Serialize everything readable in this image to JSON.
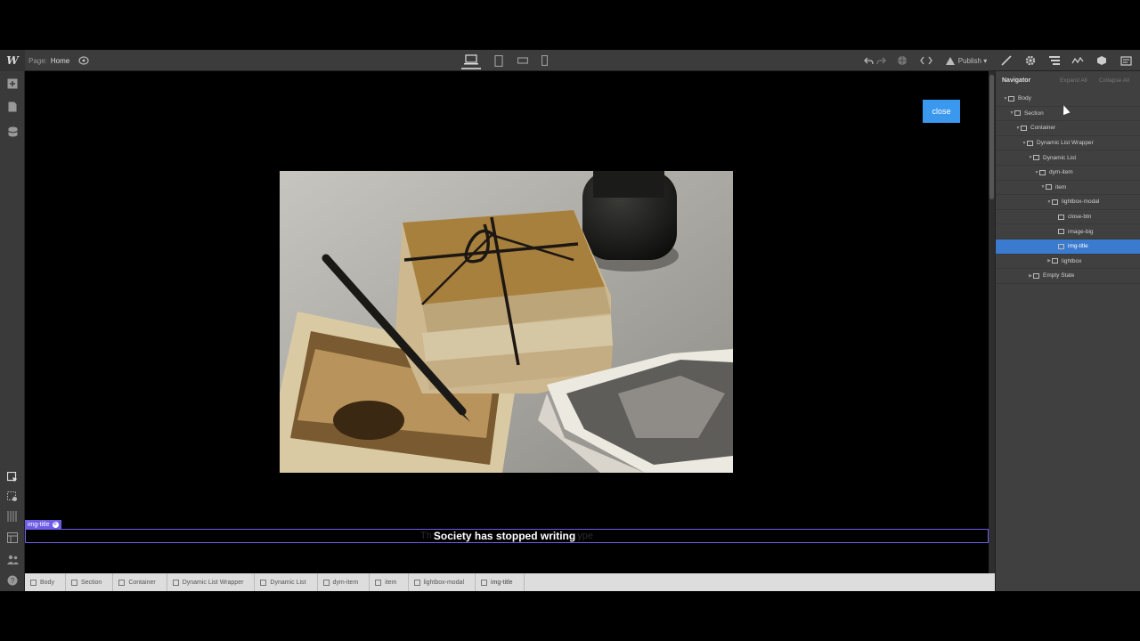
{
  "topbar": {
    "logo": "W",
    "page_prefix": "Page:",
    "page_name": "Home",
    "publish_label": "Publish ▾"
  },
  "canvas": {
    "close_label": "close",
    "img_title": "Society has stopped writing",
    "img_title_ghost_left": "Th",
    "img_title_ghost_right": "ype",
    "selection_tag": "img-title"
  },
  "breadcrumb": [
    "Body",
    "Section",
    "Container",
    "Dynamic List Wrapper",
    "Dynamic List",
    "dym-item",
    "item",
    "lightbox-modal",
    "img-title"
  ],
  "navigator": {
    "title": "Navigator",
    "expand_all": "Expand All",
    "collapse_all": "Collapse All",
    "nodes": [
      {
        "label": "Body",
        "depth": 0
      },
      {
        "label": "Section",
        "depth": 1
      },
      {
        "label": "Container",
        "depth": 2
      },
      {
        "label": "Dynamic List Wrapper",
        "depth": 3
      },
      {
        "label": "Dynamic List",
        "depth": 4
      },
      {
        "label": "dym-item",
        "depth": 5
      },
      {
        "label": "item",
        "depth": 6
      },
      {
        "label": "lightbox-modal",
        "depth": 7
      },
      {
        "label": "close-btn",
        "depth": 8
      },
      {
        "label": "image-big",
        "depth": 8
      },
      {
        "label": "img-title",
        "depth": 8,
        "selected": true
      },
      {
        "label": "lightbox",
        "depth": 7
      },
      {
        "label": "Empty State",
        "depth": 4
      }
    ]
  },
  "colors": {
    "accent": "#3b98ef",
    "selection": "#6e5ce6",
    "nav_selected": "#3b7bcf"
  }
}
